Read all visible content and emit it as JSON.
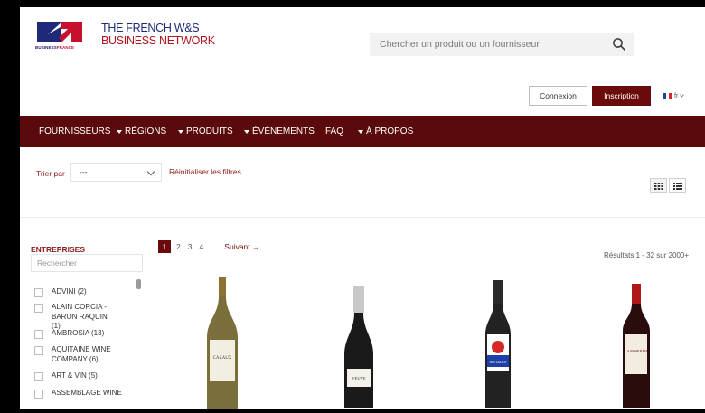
{
  "brand": {
    "logo_text_blue": "BUSINESS",
    "logo_text_red": "FRANCE",
    "line1": "THE FRENCH W&S",
    "line2": "BUSINESS NETWORK",
    "colors": {
      "blue": "#1e2a78",
      "red": "#b5121b",
      "primary_dark": "#5a0a0a"
    }
  },
  "search": {
    "placeholder": "Chercher un produit ou un fournisseur",
    "icon": "search-icon"
  },
  "auth": {
    "login_label": "Connexion",
    "signup_label": "Inscription"
  },
  "language": {
    "code": "fr",
    "icon": "french-flag-icon"
  },
  "nav": [
    {
      "label": "FOURNISSEURS",
      "dropdown": false
    },
    {
      "label": "RÉGIONS",
      "dropdown": true
    },
    {
      "label": "PRODUITS",
      "dropdown": true
    },
    {
      "label": "ÉVÉNEMENTS",
      "dropdown": true
    },
    {
      "label": "FAQ",
      "dropdown": false
    },
    {
      "label": "À PROPOS",
      "dropdown": true
    }
  ],
  "filters": {
    "sort_label": "Trier par",
    "sort_value": "---",
    "reset_label": "Réinitialiser les filtres"
  },
  "view_toggle": {
    "grid_icon": "grid-view-icon",
    "list_icon": "list-view-icon",
    "active": "grid"
  },
  "sidebar": {
    "title": "ENTREPRISES",
    "search_placeholder": "Rechercher",
    "items": [
      {
        "label": "ADVINI (2)"
      },
      {
        "label": "ALAIN CORCIA - BARON RAQUIN (1)"
      },
      {
        "label": "AMBROSIA (13)"
      },
      {
        "label": "AQUITAINE WINE COMPANY (6)"
      },
      {
        "label": "ART & VIN (5)"
      },
      {
        "label": "ASSEMBLAGE WINE"
      }
    ]
  },
  "pagination": {
    "pages": [
      "1",
      "2",
      "3",
      "4"
    ],
    "current": "1",
    "ellipsis": "...",
    "next_label": "Suivant →"
  },
  "results_text": "Résultats 1 - 32 sur 2000+",
  "products": [
    {
      "label": "CAZAUX",
      "glass": "#7a6f3a",
      "capsule": "#8a7332"
    },
    {
      "label": "VEUVE",
      "glass": "#1a1a1a",
      "capsule": "#c8c8c8"
    },
    {
      "label": "INITIALES",
      "glass": "#222",
      "capsule": "#2a2a2a"
    },
    {
      "label": "LA ROSERAIE",
      "glass": "#2a0c0c",
      "capsule": "#b01818"
    }
  ]
}
